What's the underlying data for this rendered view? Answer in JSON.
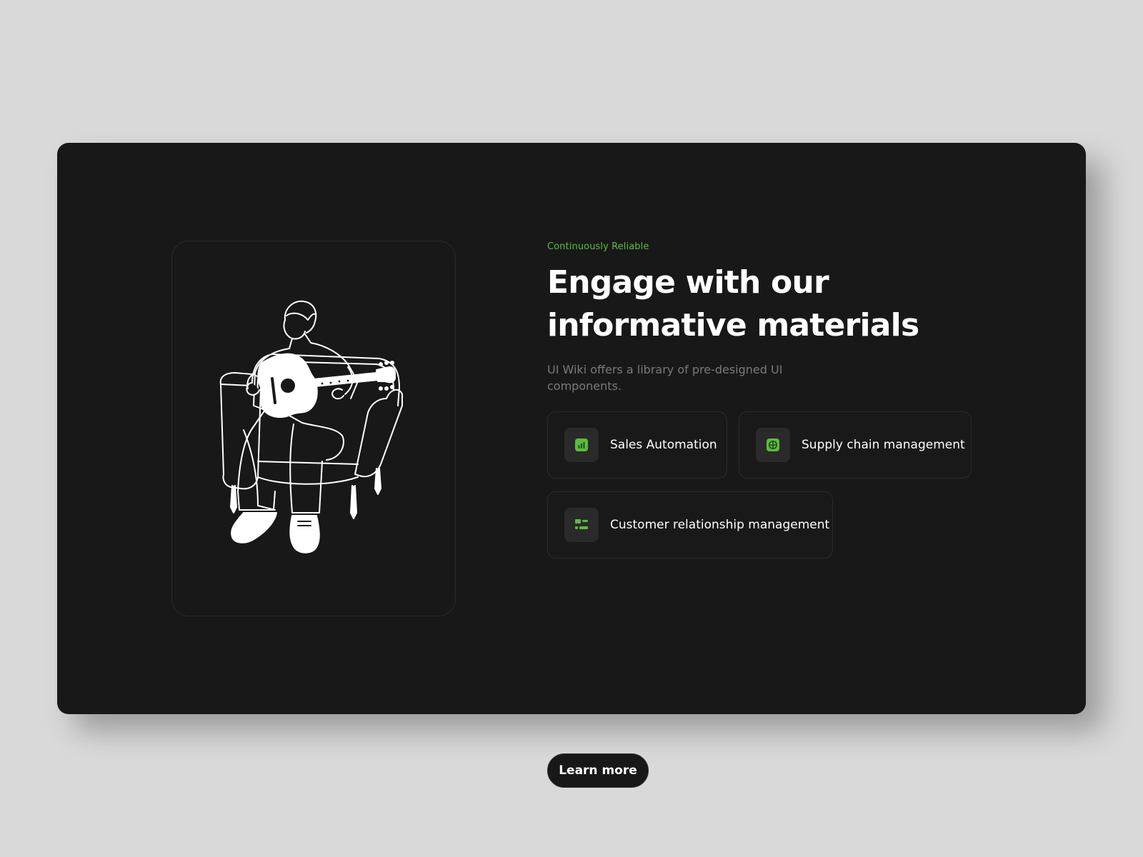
{
  "hero": {
    "eyebrow": "Continuously Reliable",
    "title_line1": "Engage with our",
    "title_line2": "informative materials",
    "subtitle": "UI Wiki offers a library of pre-designed UI components."
  },
  "features": [
    {
      "label": "Sales Automation",
      "icon": "bar-chart-icon"
    },
    {
      "label": "Supply chain management",
      "icon": "grid-plus-icon"
    },
    {
      "label": "Customer relationship management",
      "icon": "layout-icon"
    }
  ],
  "cta": {
    "label": "Learn more"
  },
  "illustration": {
    "subject": "man-playing-guitar-illustration"
  },
  "colors": {
    "background": "#d9d9d9",
    "card": "#181818",
    "accent": "#5bbd3c",
    "text": "#ffffff",
    "muted": "#7a7a7a"
  }
}
